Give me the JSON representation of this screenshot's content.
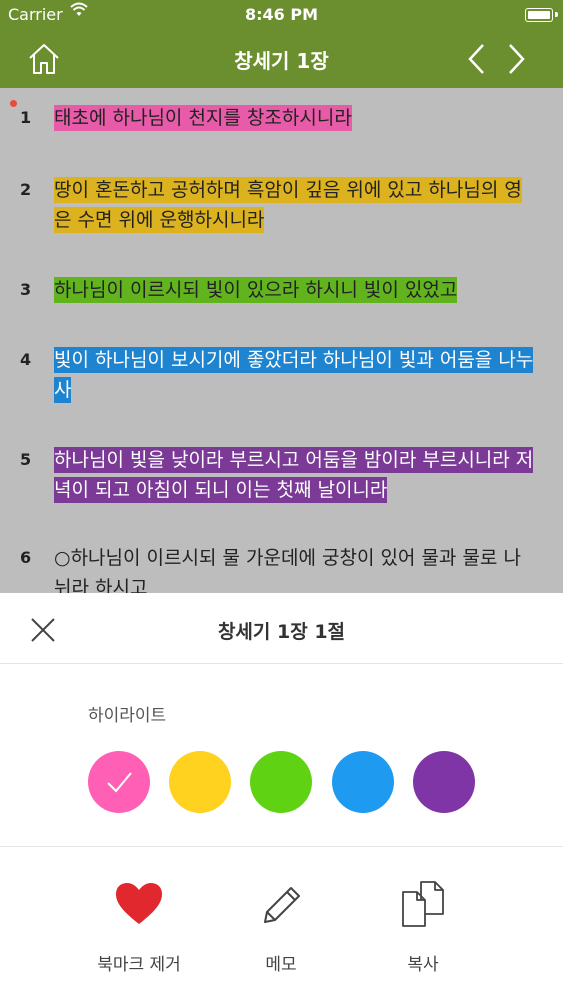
{
  "status_bar": {
    "carrier": "Carrier",
    "time": "8:46 PM"
  },
  "nav": {
    "title": "창세기 1장"
  },
  "verses": [
    {
      "num": "1",
      "text": "태초에 하나님이 천지를 창조하시니라",
      "highlight": "#e85ba8"
    },
    {
      "num": "2",
      "text": "땅이 혼돈하고 공허하며 흑암이 깊음 위에 있고 하나님의 영은 수면 위에 운행하시니라",
      "highlight": "#dcb21f"
    },
    {
      "num": "3",
      "text": "하나님이 이르시되 빛이 있으라 하시니 빛이 있었고",
      "highlight": "#62b41e"
    },
    {
      "num": "4",
      "text": "빛이 하나님이 보시기에 좋았더라 하나님이 빛과 어둠을 나누사",
      "highlight": "#1e84cf"
    },
    {
      "num": "5",
      "text": "하나님이 빛을 낮이라 부르시고 어둠을 밤이라 부르시니라 저녁이 되고 아침이 되니 이는 첫째 날이니라",
      "highlight": "#7a3a96"
    },
    {
      "num": "6",
      "text": "○하나님이 이르시되 물 가운데에 궁창이 있어 물과 물로 나뉘라 하시고",
      "highlight": ""
    }
  ],
  "sheet": {
    "title": "창세기 1장 1절",
    "highlight_label": "하이라이트",
    "colors": [
      {
        "name": "pink",
        "hex": "#ff5fb4",
        "selected": true
      },
      {
        "name": "yellow",
        "hex": "#ffd21f",
        "selected": false
      },
      {
        "name": "green",
        "hex": "#5fd214",
        "selected": false
      },
      {
        "name": "blue",
        "hex": "#1e9bf0",
        "selected": false
      },
      {
        "name": "purple",
        "hex": "#7f35a6",
        "selected": false
      }
    ],
    "actions": {
      "remove_bookmark": "북마크 제거",
      "memo": "메모",
      "copy": "복사"
    }
  },
  "colors": {
    "nav_bg": "#6b8e2e",
    "bookmark_red": "#e0282e"
  }
}
